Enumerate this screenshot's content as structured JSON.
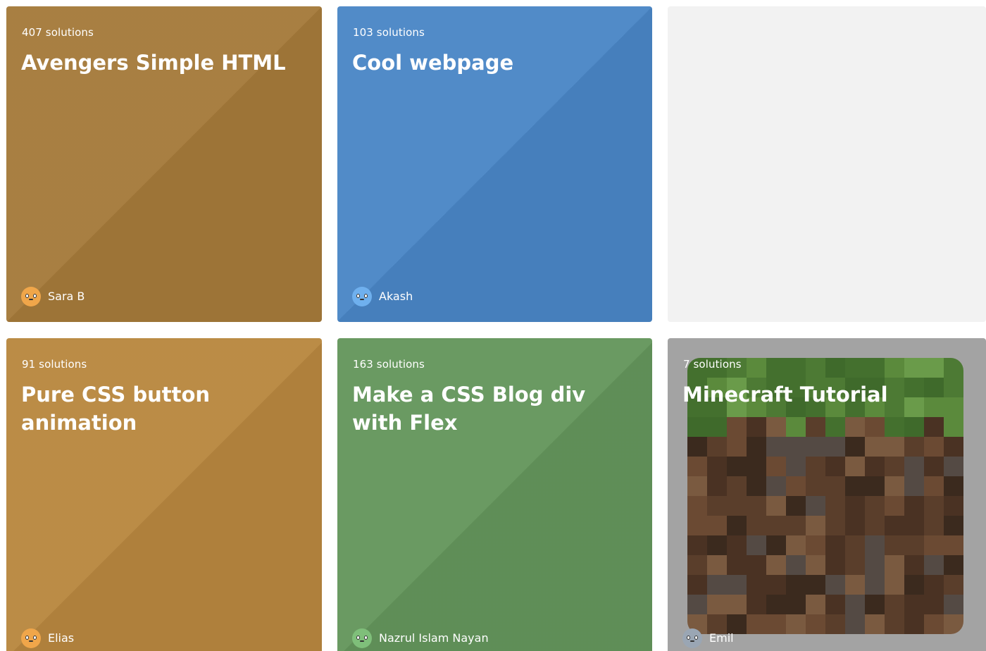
{
  "colors": {
    "avengers": "#a57a3a",
    "cool": "#4a86c6",
    "placeholder": "#f2f2f2",
    "pure_css": "#b8873f",
    "blog": "#64965c",
    "minecraft_bg": "#a3a3a3",
    "avatar_orange": "#f0a64a",
    "avatar_blue": "#6fb0ee",
    "avatar_green": "#7fbf7a",
    "avatar_grey": "#9aa6b4"
  },
  "cards": [
    {
      "count": "407 solutions",
      "title": "Avengers Simple HTML",
      "author": "Sara B",
      "avatar": "smiley-avatar-icon"
    },
    {
      "count": "103 solutions",
      "title": "Cool webpage",
      "author": "Akash",
      "avatar": "smiley-avatar-icon"
    },
    {
      "count": "91 solutions",
      "title": "Pure CSS button animation",
      "author": "Elias",
      "avatar": "smiley-avatar-icon"
    },
    {
      "count": "163 solutions",
      "title": "Make a CSS Blog div with Flex",
      "author": "Nazrul Islam Nayan",
      "avatar": "smiley-avatar-icon"
    },
    {
      "count": "7 solutions",
      "title": "Minecraft Tutorial",
      "author": "Emil",
      "avatar": "smiley-avatar-icon",
      "thumbnail": "minecraft-grass-block-image"
    }
  ]
}
